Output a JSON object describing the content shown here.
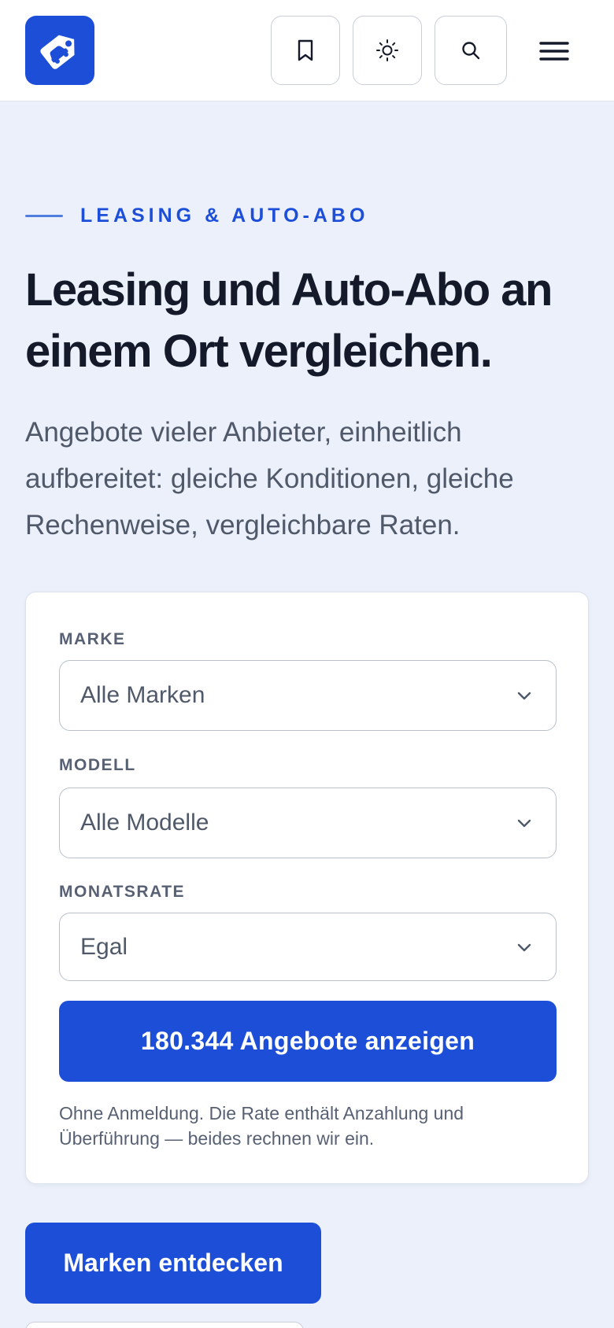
{
  "header": {
    "logo_icon": "price-tag-car-icon",
    "buttons": [
      {
        "icon": "bookmark-icon"
      },
      {
        "icon": "sun-icon"
      },
      {
        "icon": "search-icon"
      }
    ],
    "menu_icon": "hamburger-menu-icon"
  },
  "hero": {
    "eyebrow": "LEASING & AUTO-ABO",
    "title": "Leasing und Auto-Abo an einem Ort vergleichen.",
    "lead": "Angebote vieler Anbieter, einheitlich aufbereitet: gleiche Konditionen, gleiche Rechenweise, vergleichbare Raten."
  },
  "search_card": {
    "brand_label": "MARKE",
    "brand_value": "Alle Marken",
    "model_label": "MODELL",
    "model_value": "Alle Modelle",
    "rate_label": "MONATSRATE",
    "rate_value": "Egal",
    "submit_label": "180.344 Angebote anzeigen",
    "note": "Ohne Anmeldung. Die Rate enthält Anzahlung und Überführung — beides rechnen wir ein."
  },
  "actions": {
    "brands_label": "Marken entdecken"
  },
  "colors": {
    "accent": "#1d4ed8",
    "background": "#ebf0fb",
    "heading": "#141a29",
    "muted": "#4f5969"
  }
}
